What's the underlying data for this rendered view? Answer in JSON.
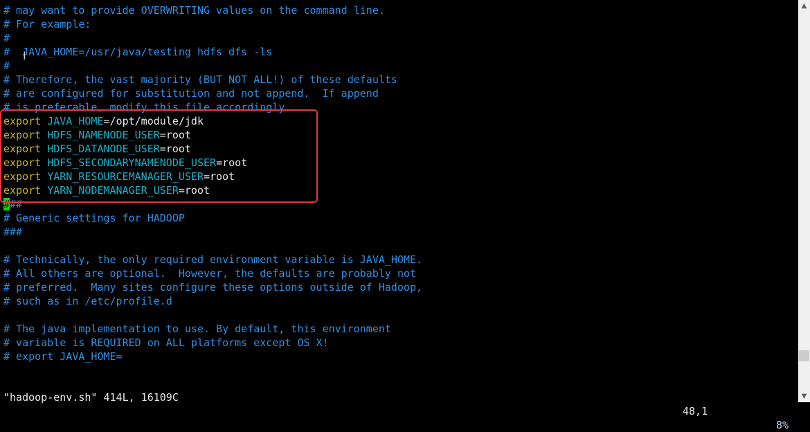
{
  "editor": {
    "lines": [
      {
        "type": "comment",
        "text": "# may want to provide OVERWRITING values on the command line."
      },
      {
        "type": "comment",
        "text": "# For example:"
      },
      {
        "type": "comment",
        "text": "#"
      },
      {
        "type": "comment",
        "text": "#  JAVA_HOME=/usr/java/testing hdfs dfs -ls"
      },
      {
        "type": "comment",
        "text": "#"
      },
      {
        "type": "comment",
        "text": "# Therefore, the vast majority (BUT NOT ALL!) of these defaults"
      },
      {
        "type": "comment",
        "text": "# are configured for substitution and not append.  If append"
      },
      {
        "type": "comment",
        "text": "# is preferable, modify this file accordingly."
      },
      {
        "type": "export",
        "keyword": "export",
        "name": "JAVA_HOME",
        "value": "=/opt/module/jdk"
      },
      {
        "type": "export",
        "keyword": "export",
        "name": "HDFS_NAMENODE_USER",
        "value": "=root"
      },
      {
        "type": "export",
        "keyword": "export",
        "name": "HDFS_DATANODE_USER",
        "value": "=root"
      },
      {
        "type": "export",
        "keyword": "export",
        "name": "HDFS_SECONDARYNAMENODE_USER",
        "value": "=root"
      },
      {
        "type": "export",
        "keyword": "export",
        "name": "YARN_RESOURCEMANAGER_USER",
        "value": "=root"
      },
      {
        "type": "export",
        "keyword": "export",
        "name": "YARN_NODEMANAGER_USER",
        "value": "=root"
      },
      {
        "type": "cursor",
        "cursor_char": "#",
        "text": "##"
      },
      {
        "type": "comment",
        "text": "# Generic settings for HADOOP"
      },
      {
        "type": "comment",
        "text": "###"
      },
      {
        "type": "blank",
        "text": ""
      },
      {
        "type": "comment",
        "text": "# Technically, the only required environment variable is JAVA_HOME."
      },
      {
        "type": "comment",
        "text": "# All others are optional.  However, the defaults are probably not"
      },
      {
        "type": "comment",
        "text": "# preferred.  Many sites configure these options outside of Hadoop,"
      },
      {
        "type": "comment",
        "text": "# such as in /etc/profile.d"
      },
      {
        "type": "blank",
        "text": ""
      },
      {
        "type": "comment",
        "text": "# The java implementation to use. By default, this environment"
      },
      {
        "type": "comment",
        "text": "# variable is REQUIRED on ALL platforms except OS X!"
      },
      {
        "type": "comment",
        "text": "# export JAVA_HOME="
      }
    ]
  },
  "status": {
    "file_info": "\"hadoop-env.sh\" 414L, 16109C",
    "position": "48,1",
    "percent": "8%"
  },
  "scrollbar": {
    "position_percent": 8,
    "up_icon": "chevron-up-icon",
    "down_icon": "chevron-down-icon"
  },
  "colors": {
    "comment": "#2f8fe6",
    "keyword": "#c8b41e",
    "variable": "#1ab0c8",
    "highlight_box": "#e8363c",
    "cursor": "#00e000"
  }
}
